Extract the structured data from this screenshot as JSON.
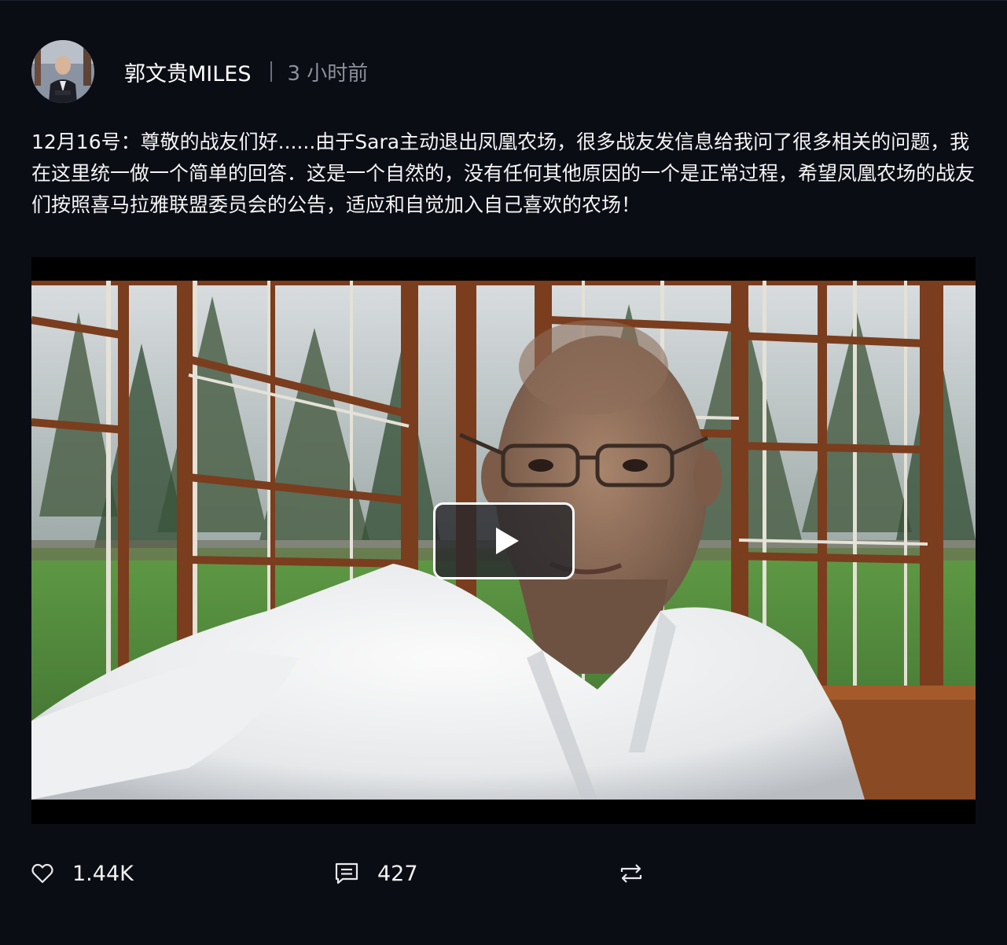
{
  "post": {
    "author": "郭文贵MILES",
    "time": "3 小时前",
    "content": "12月16号：尊敬的战友们好......由于Sara主动退出凤凰农场，很多战友发信息给我问了很多相关的问题，我在这里统一做一个简单的回答．这是一个自然的，没有任何其他原因的一个是正常过程，希望凤凰农场的战友们按照喜马拉雅联盟委员会的公告，适应和自觉加入自己喜欢的农场！"
  },
  "video": {
    "play_icon": "play-icon"
  },
  "actions": {
    "likes": "1.44K",
    "comments": "427",
    "like_icon": "heart-icon",
    "comment_icon": "comment-icon",
    "repost_icon": "repost-icon"
  },
  "colors": {
    "background": "#0b0d15",
    "text": "#f2f2f4",
    "muted": "#8d909b"
  }
}
